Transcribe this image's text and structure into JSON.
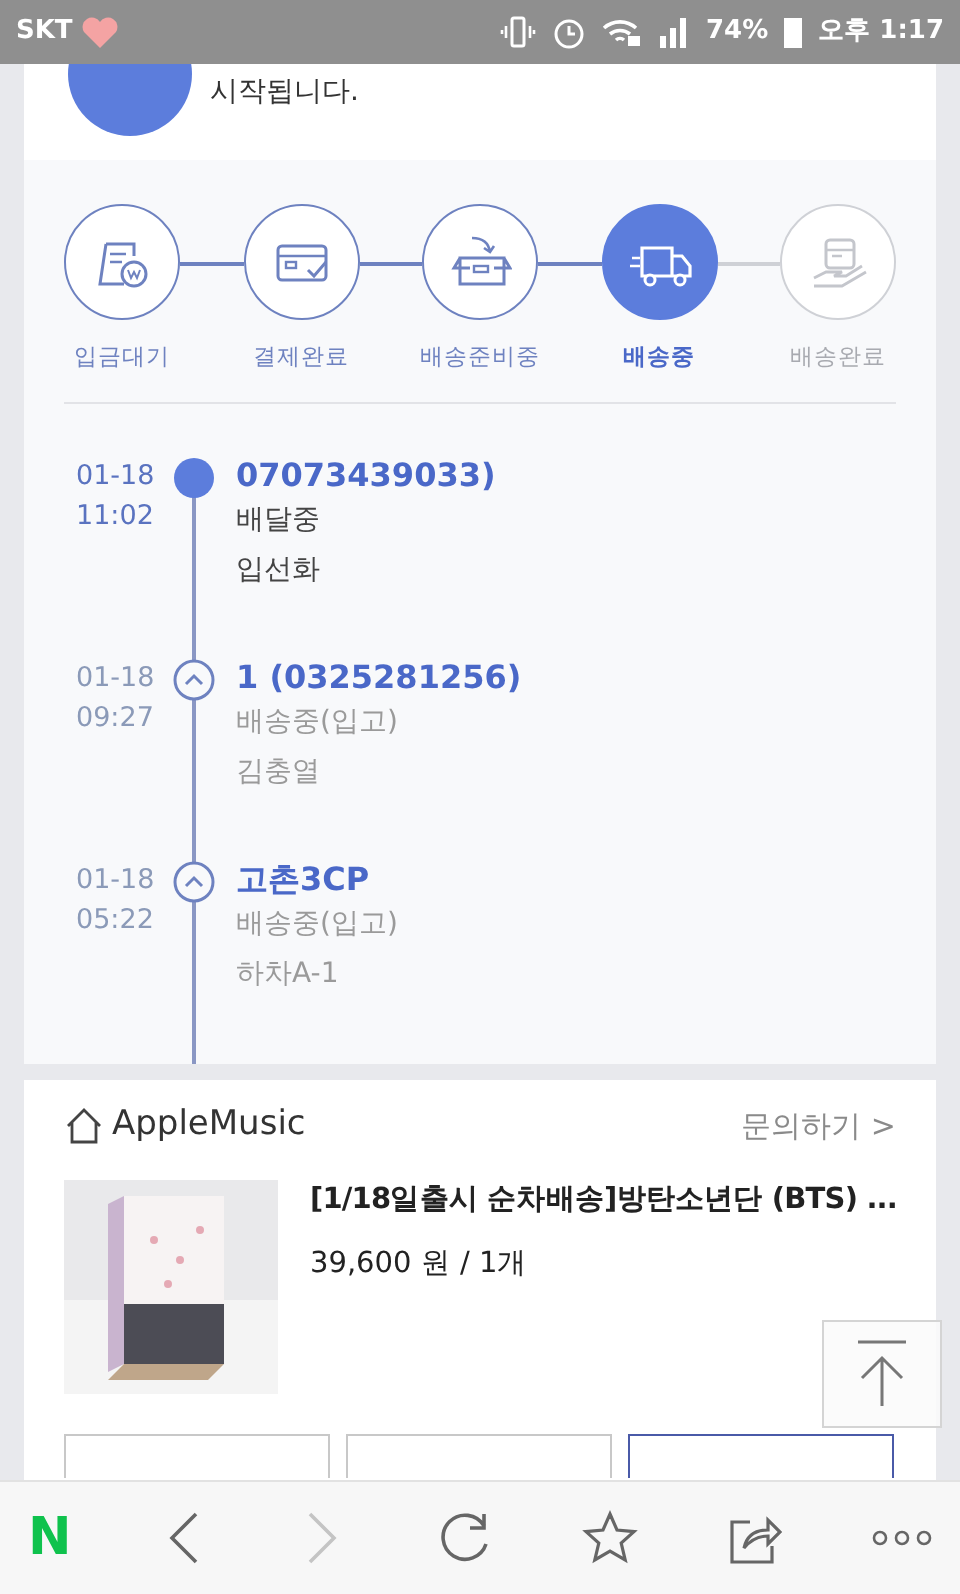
{
  "status_bar": {
    "carrier": "SKT",
    "battery": "74%",
    "time": "오후 1:17"
  },
  "notice": {
    "text": "시작됩니다."
  },
  "steps": [
    {
      "label": "입금대기",
      "kind": "money",
      "selected": false,
      "disabled": false
    },
    {
      "label": "결제완료",
      "kind": "card",
      "selected": false,
      "disabled": false
    },
    {
      "label": "배송준비중",
      "kind": "box",
      "selected": false,
      "disabled": false
    },
    {
      "label": "배송중",
      "kind": "truck",
      "selected": true,
      "disabled": false
    },
    {
      "label": "배송완료",
      "kind": "hand",
      "selected": false,
      "disabled": true
    }
  ],
  "events": [
    {
      "date": "01-18",
      "time": "11:02",
      "title": "07073439033)",
      "status": "배달중",
      "detail": "입선화",
      "current": true
    },
    {
      "date": "01-18",
      "time": "09:27",
      "title": "1 (0325281256)",
      "status": "배송중(입고)",
      "detail": "김충열",
      "current": false
    },
    {
      "date": "01-18",
      "time": "05:22",
      "title": "고촌3CP",
      "status": "배송중(입고)",
      "detail": "하차A-1",
      "current": false
    }
  ],
  "seller": {
    "name": "AppleMusic",
    "inquiry": "문의하기 >"
  },
  "product": {
    "kind": "picture",
    "title": "[1/18일출시 순차배송]방탄소년단 (BTS) ...",
    "price": "39,600 원 / 1개"
  },
  "action_buttons": [
    {
      "selected": false
    },
    {
      "selected": false
    },
    {
      "selected": true
    }
  ],
  "browser_bar": {
    "logo": "N",
    "forward_disabled": true
  }
}
